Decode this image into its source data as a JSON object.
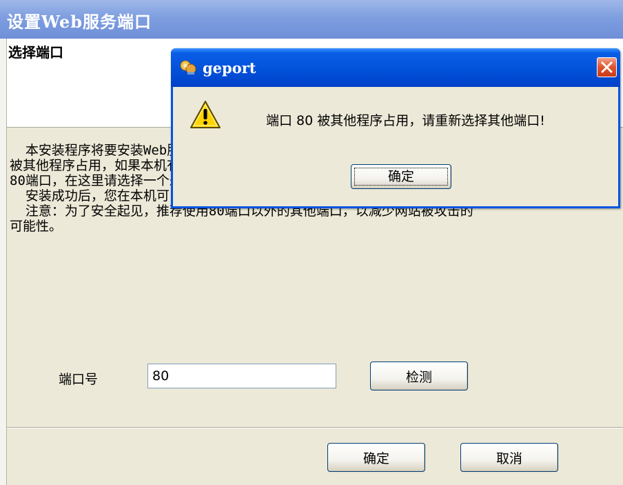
{
  "window": {
    "title": "设置Web服务端口",
    "header_title": "选择端口",
    "description": "  本安装程序将要安装Web服务器，默认使用80端口，如果80端口已经\n被其他程序占用，如果本机有其他Web服务器，则可能已经占用了\n80端口，在这里请选择一个未被占用的端口号。\n  安装成功后，您在本机可以通过http://127.0.0.1:端口号/访问。\n  注意：为了安全起见，推荐使用80端口以外的其他端口，以减少网站被攻击的\n可能性。",
    "port_label": "端口号",
    "port_value": "80",
    "check_label": "检测",
    "ok_label": "确定",
    "cancel_label": "取消"
  },
  "dialog": {
    "title": "geport",
    "message": "端口 80 被其他程序占用，请重新选择其他端口!",
    "ok_label": "确定",
    "icon": "warning-icon",
    "app_icon": "geport-app-icon",
    "close_icon": "close-icon"
  },
  "colors": {
    "titlebar": "#7e9ee0",
    "dialog_titlebar": "#0250d8",
    "close_button": "#e0532c",
    "panel": "#ece9d8",
    "warning_yellow": "#ffd400"
  }
}
